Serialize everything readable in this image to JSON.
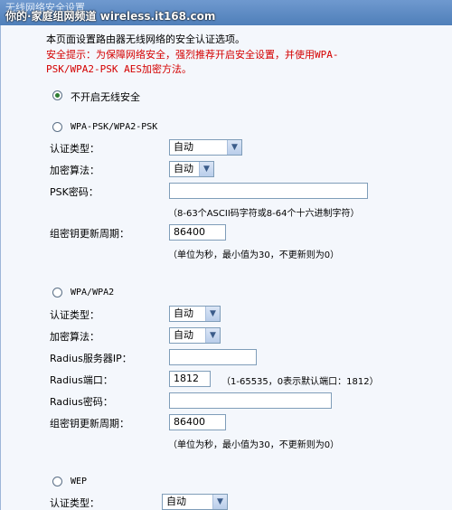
{
  "window": {
    "title": "无线网络安全设置",
    "watermark": "你的·家庭组网频道 wireless.it168.com"
  },
  "intro": "本页面设置路由器无线网络的安全认证选项。",
  "warning_lines": [
    "安全提示：为保障网络安全，强烈推荐开启安全设置，并使用WPA-",
    "PSK/WPA2-PSK AES加密方法。"
  ],
  "no_security": {
    "label": "不开启无线安全",
    "selected": true
  },
  "wpa_psk": {
    "label": "WPA-PSK/WPA2-PSK",
    "selected": false,
    "auth_type_label": "认证类型：",
    "auth_type_value": "自动",
    "encryption_label": "加密算法：",
    "encryption_value": "自动",
    "psk_label": "PSK密码：",
    "psk_value": "",
    "psk_hint": "（8-63个ASCII码字符或8-64个十六进制字符）",
    "group_key_label": "组密钥更新周期：",
    "group_key_value": "86400",
    "group_key_hint": "（单位为秒，最小值为30，不更新则为0）"
  },
  "wpa": {
    "label": "WPA/WPA2",
    "selected": false,
    "auth_type_label": "认证类型：",
    "auth_type_value": "自动",
    "encryption_label": "加密算法：",
    "encryption_value": "自动",
    "radius_ip_label": "Radius服务器IP：",
    "radius_ip_value": "",
    "radius_port_label": "Radius端口：",
    "radius_port_value": "1812",
    "radius_port_hint": "（1-65535，0表示默认端口：1812）",
    "radius_pwd_label": "Radius密码：",
    "radius_pwd_value": "",
    "group_key_label": "组密钥更新周期：",
    "group_key_value": "86400",
    "group_key_hint": "（单位为秒，最小值为30，不更新则为0）"
  },
  "wep": {
    "label": "WEP",
    "selected": false,
    "auth_type_label": "认证类型：",
    "auth_type_value": "自动"
  },
  "icons": {
    "dropdown": "chevron-down-icon"
  }
}
